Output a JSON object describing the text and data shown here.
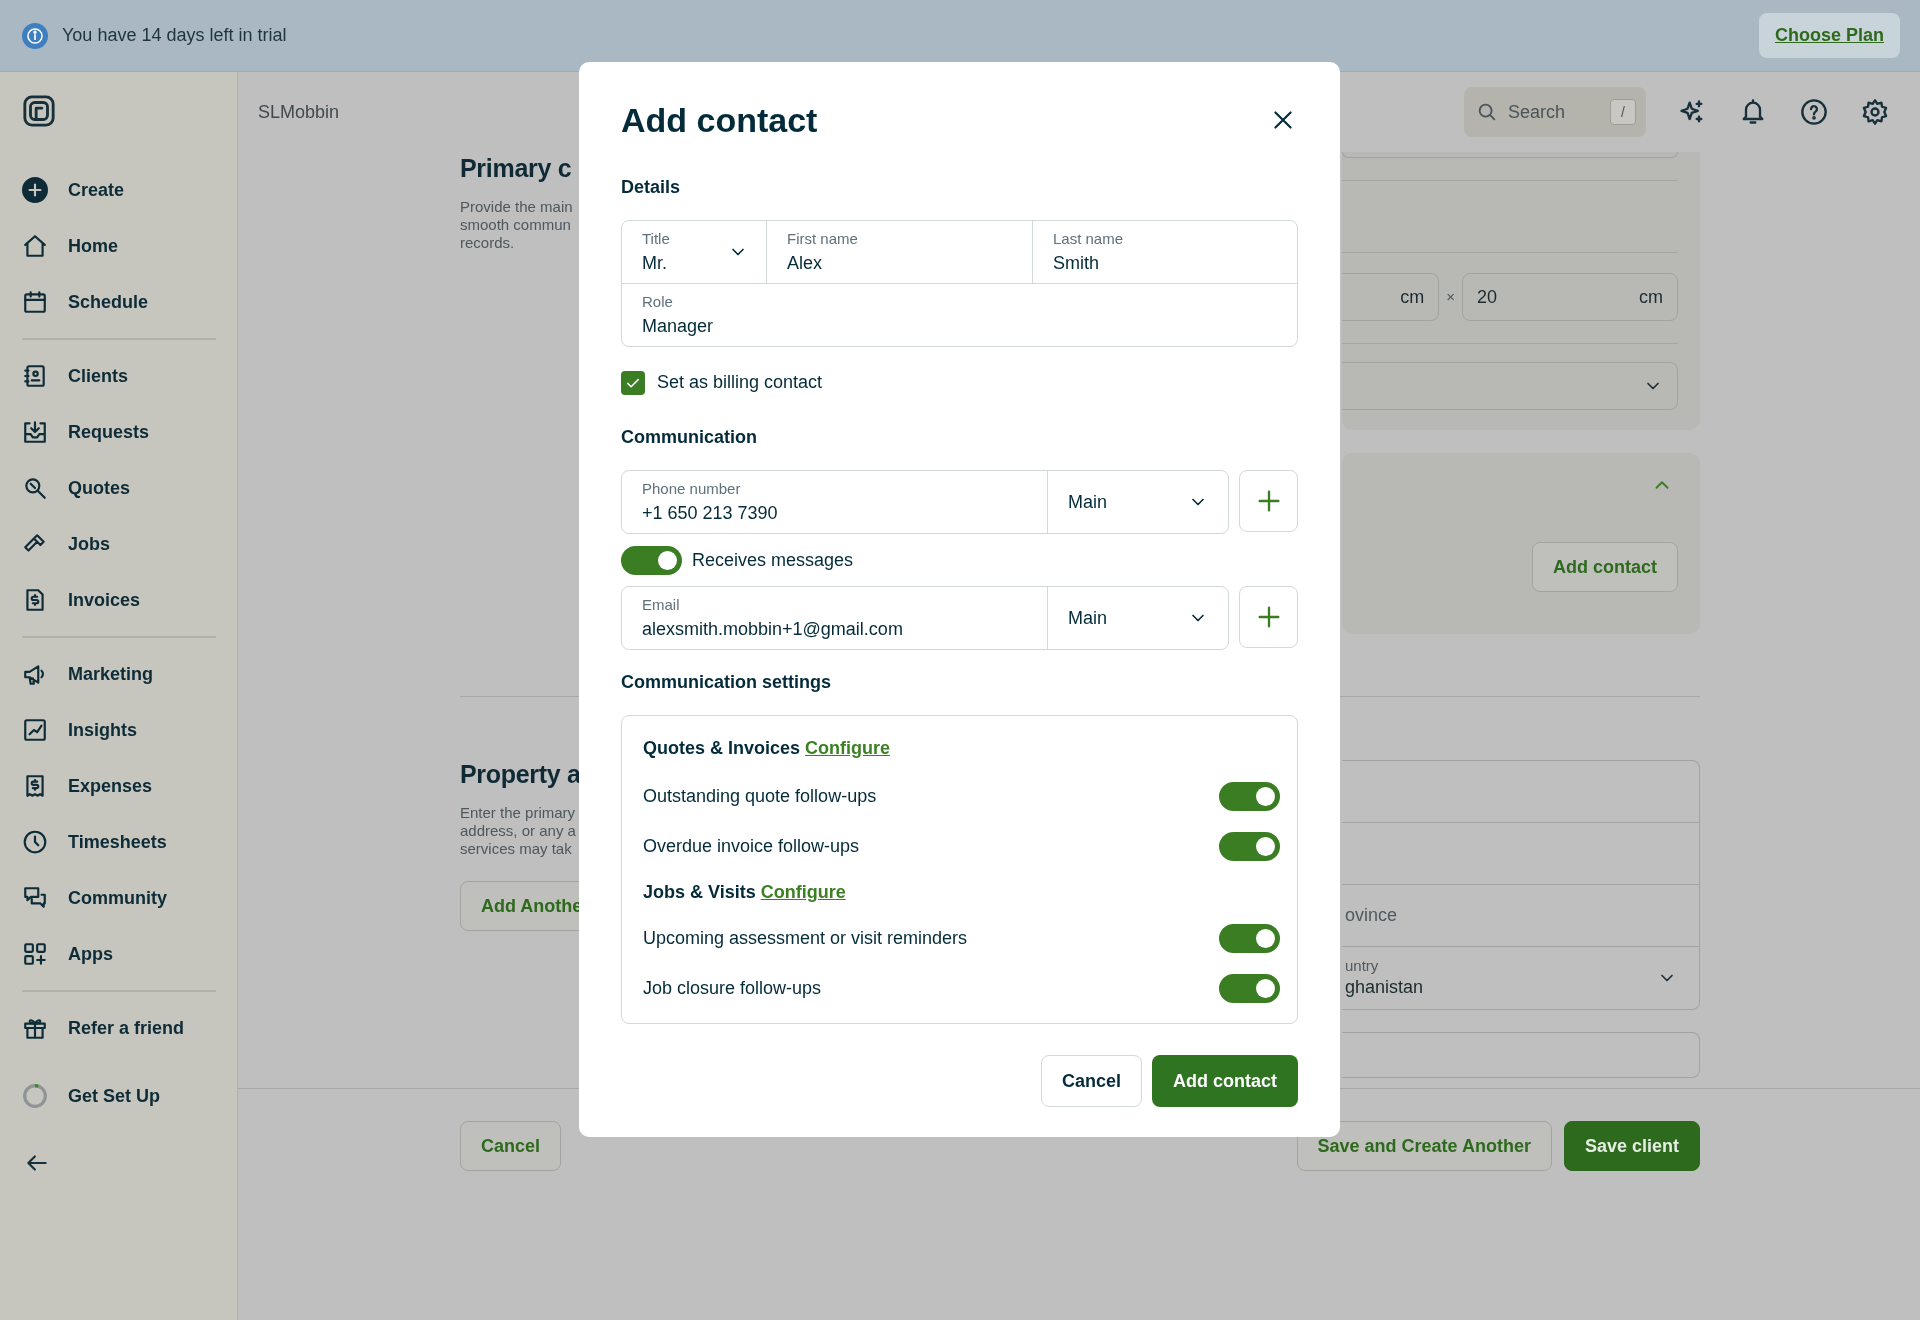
{
  "trial_banner": {
    "message": "You have 14 days left in trial",
    "action": "Choose Plan"
  },
  "sidebar": {
    "groups": [
      [
        {
          "label": "Create"
        },
        {
          "label": "Home"
        },
        {
          "label": "Schedule"
        }
      ],
      [
        {
          "label": "Clients"
        },
        {
          "label": "Requests"
        },
        {
          "label": "Quotes"
        },
        {
          "label": "Jobs"
        },
        {
          "label": "Invoices"
        }
      ],
      [
        {
          "label": "Marketing"
        },
        {
          "label": "Insights"
        },
        {
          "label": "Expenses"
        },
        {
          "label": "Timesheets"
        },
        {
          "label": "Community"
        },
        {
          "label": "Apps"
        }
      ],
      [
        {
          "label": "Refer a friend"
        }
      ]
    ],
    "setup": {
      "label": "Get Set Up",
      "level": 0.05
    }
  },
  "header": {
    "account": "SLMobbin",
    "search": {
      "placeholder": "Search",
      "shortcut": "/"
    }
  },
  "background_form": {
    "primary_section": {
      "title": "Primary c",
      "description_lines": [
        "Provide the main",
        "smooth commun",
        "records."
      ]
    },
    "dimensions": {
      "unit_1": "cm",
      "separator": "×",
      "value_2": "20",
      "unit_2": "cm"
    },
    "contacts_panel": {
      "expanded": true,
      "button": "Add contact"
    },
    "property_section": {
      "title": "Property a",
      "description_lines": [
        "Enter the primary",
        "address, or any a",
        "services may tak"
      ],
      "button": "Add Anothe"
    },
    "address": {
      "province_placeholder": "ovince",
      "country_label": "untry",
      "country_value": "ghanistan"
    },
    "footer": {
      "cancel": "Cancel",
      "save_another": "Save and Create Another",
      "save": "Save client"
    }
  },
  "modal": {
    "title": "Add contact",
    "details_heading": "Details",
    "name_fields": [
      {
        "label": "Title",
        "value": "Mr.",
        "kind": "select"
      },
      {
        "label": "First name",
        "value": "Alex",
        "kind": "text"
      },
      {
        "label": "Last name",
        "value": "Smith",
        "kind": "text"
      }
    ],
    "role": {
      "label": "Role",
      "value": "Manager"
    },
    "billing_contact": {
      "label": "Set as billing contact",
      "checked": true
    },
    "communication_heading": "Communication",
    "phone": {
      "label": "Phone number",
      "value": "+1 650 213 7390",
      "type": "Main"
    },
    "receives_messages": {
      "label": "Receives messages",
      "on": true
    },
    "email": {
      "label": "Email",
      "value": "alexsmith.mobbin+1@gmail.com",
      "type": "Main"
    },
    "settings_heading": "Communication settings",
    "settings_groups": [
      {
        "title": "Quotes & Invoices",
        "link": "Configure",
        "items": [
          {
            "label": "Outstanding quote follow-ups",
            "on": true
          },
          {
            "label": "Overdue invoice follow-ups",
            "on": true
          }
        ]
      },
      {
        "title": "Jobs & Visits",
        "link": "Configure",
        "items": [
          {
            "label": "Upcoming assessment or visit reminders",
            "on": true
          },
          {
            "label": "Job closure follow-ups",
            "on": true
          }
        ]
      }
    ],
    "buttons": {
      "cancel": "Cancel",
      "confirm": "Add contact"
    }
  }
}
